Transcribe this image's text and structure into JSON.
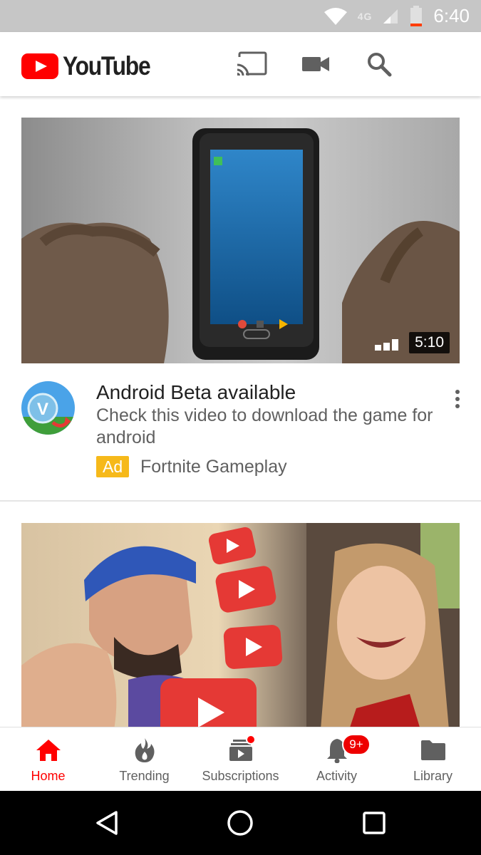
{
  "status_bar": {
    "time": "6:40",
    "network": "4G",
    "icons": [
      "wifi-icon",
      "cell-signal-icon",
      "battery-low-icon"
    ]
  },
  "header": {
    "logo_text": "YouTube",
    "icons": [
      "cast-icon",
      "video-camera-icon",
      "search-icon",
      "account-avatar"
    ]
  },
  "feed": {
    "items": [
      {
        "duration": "5:10",
        "title": "Android Beta available",
        "description": "Check this video to download the game for android",
        "badge": "Ad",
        "channel": "Fortnite Gameplay"
      },
      {
        "title": ""
      }
    ]
  },
  "bottom_nav": {
    "items": [
      {
        "label": "Home",
        "icon": "home-icon",
        "active": true
      },
      {
        "label": "Trending",
        "icon": "flame-icon"
      },
      {
        "label": "Subscriptions",
        "icon": "subscriptions-icon"
      },
      {
        "label": "Activity",
        "icon": "bell-icon",
        "badge": "9+"
      },
      {
        "label": "Library",
        "icon": "folder-icon"
      }
    ]
  },
  "colors": {
    "brand_red": "#ff0000",
    "ad_yellow": "#f6b91a",
    "text_primary": "#212121",
    "text_secondary": "#606060"
  }
}
